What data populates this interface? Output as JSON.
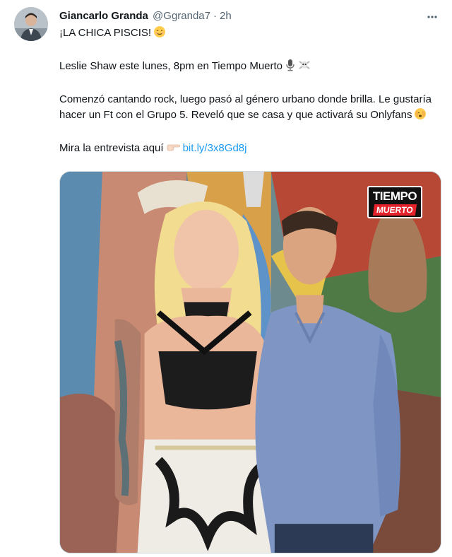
{
  "author": {
    "name": "Giancarlo Granda",
    "handle": "@Ggranda7",
    "separator": "·",
    "time": "2h"
  },
  "tweet": {
    "line1": "¡LA CHICA PISCIS!",
    "line1_emoji": "😌",
    "line2": "Leslie Shaw este lunes, 8pm en Tiempo Muerto",
    "line2_emojis": [
      "microphone-icon",
      "skull-crossbones-icon"
    ],
    "line3": "Comenzó cantando rock, luego pasó al género urbano donde brilla. Le gustaría hacer un Ft con el Grupo 5. Reveló que se casa y que activará su Onlyfans",
    "line3_emoji": "🫣",
    "line4": "Mira la entrevista aquí",
    "line4_emoji": "👉🏻",
    "link": "bit.ly/3x8Gd8j"
  },
  "media": {
    "logo_line1": "TIEMPO",
    "logo_line2": "MUERTO"
  },
  "colors": {
    "link": "#1d9bf0",
    "secondary_text": "#536471",
    "border": "#cfd9de",
    "logo_red": "#e4222b"
  }
}
